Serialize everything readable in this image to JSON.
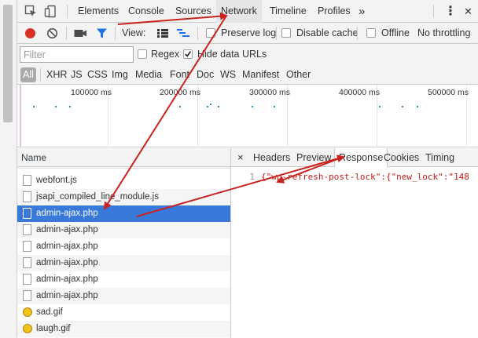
{
  "tabs": [
    "Elements",
    "Console",
    "Sources",
    "Network",
    "Timeline",
    "Profiles"
  ],
  "selected_tab": "Network",
  "more_tabs_glyph": "»",
  "menu_glyph": "⋮",
  "close_glyph": "✕",
  "toolbar": {
    "view_label": "View:",
    "preserve_log": "Preserve log",
    "disable_cache": "Disable cache",
    "offline": "Offline",
    "throttling": "No throttling"
  },
  "filter": {
    "placeholder": "Filter",
    "regex": "Regex",
    "hide_data_urls": "Hide data URLs",
    "hide_data_urls_checked": true,
    "types": [
      "All",
      "XHR",
      "JS",
      "CSS",
      "Img",
      "Media",
      "Font",
      "Doc",
      "WS",
      "Manifest",
      "Other"
    ]
  },
  "overview": {
    "ticks": [
      "100000 ms",
      "200000 ms",
      "300000 ms",
      "400000 ms",
      "500000 ms"
    ]
  },
  "requests": {
    "header": "Name",
    "rows": [
      {
        "name": "webfont.js",
        "kind": "file"
      },
      {
        "name": "jsapi_compiled_line_module.js",
        "kind": "file"
      },
      {
        "name": "admin-ajax.php",
        "kind": "file",
        "selected": true
      },
      {
        "name": "admin-ajax.php",
        "kind": "file"
      },
      {
        "name": "admin-ajax.php",
        "kind": "file"
      },
      {
        "name": "admin-ajax.php",
        "kind": "file"
      },
      {
        "name": "admin-ajax.php",
        "kind": "file"
      },
      {
        "name": "admin-ajax.php",
        "kind": "file"
      },
      {
        "name": "sad.gif",
        "kind": "gif"
      },
      {
        "name": "laugh.gif",
        "kind": "gif"
      }
    ]
  },
  "response_panel": {
    "close_glyph": "×",
    "tabs": [
      "Headers",
      "Preview",
      "Response",
      "Cookies",
      "Timing"
    ],
    "active_tab": "Response",
    "line_number": "1",
    "content": "{\"wp-refresh-post-lock\":{\"new_lock\":\"148"
  },
  "colors": {
    "record": "#d93025",
    "selected_row": "#3879d9",
    "filter_active": "#1a73e8",
    "annotation_arrow": "#c8231e"
  }
}
